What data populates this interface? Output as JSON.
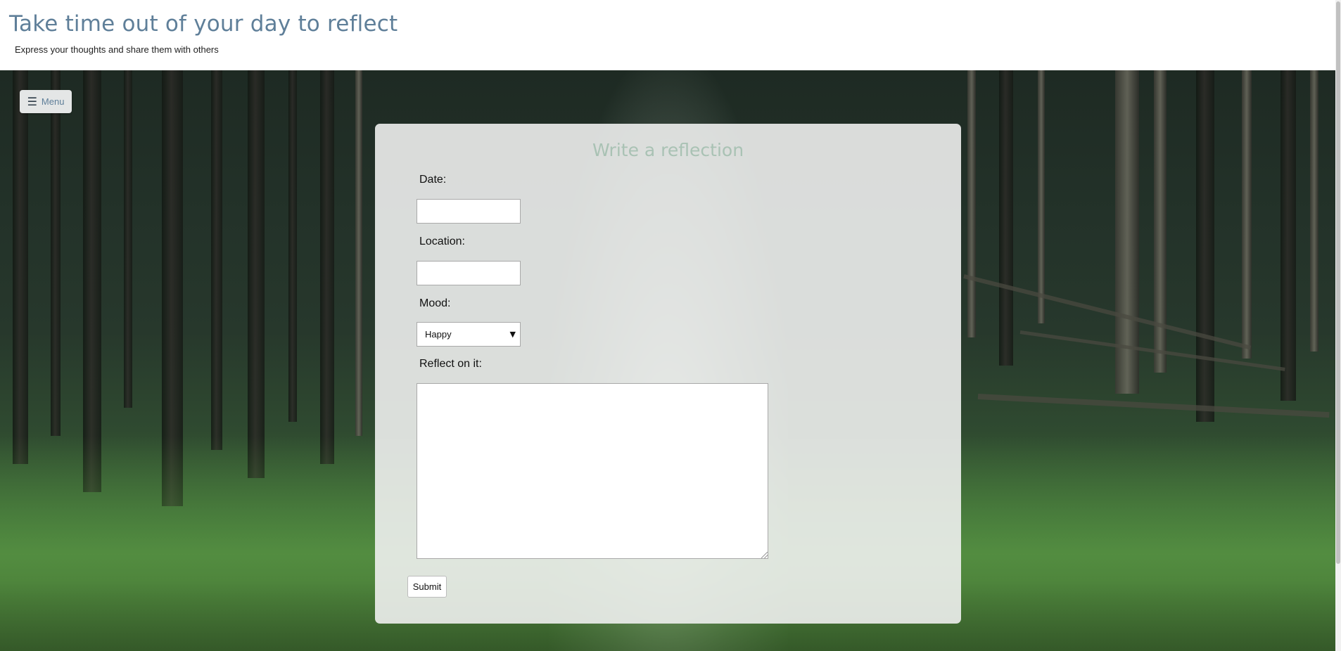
{
  "header": {
    "title": "Take time out of your day to reflect",
    "subtitle": "Express your thoughts and share them with others"
  },
  "menu": {
    "icon": "hamburger-icon",
    "label": "Menu"
  },
  "form": {
    "title": "Write a reflection",
    "date_label": "Date:",
    "date_value": "",
    "location_label": "Location:",
    "location_value": "",
    "mood_label": "Mood:",
    "mood_selected": "Happy",
    "reflect_label": "Reflect on it:",
    "reflect_value": "",
    "submit_label": "Submit"
  },
  "colors": {
    "title": "#5f7f99",
    "card_title": "#a9c2b4",
    "card_background": "#eef0ee"
  }
}
